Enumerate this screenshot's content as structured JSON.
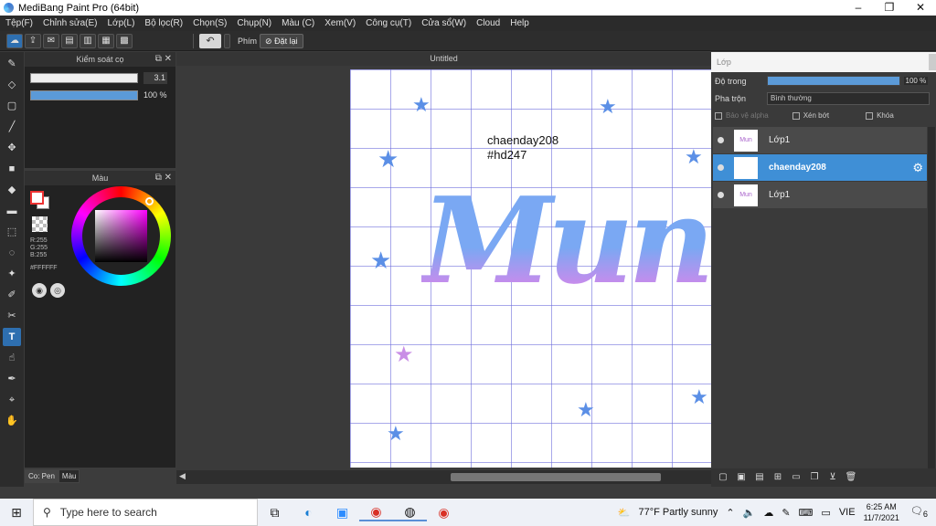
{
  "window": {
    "title": "MediBang Paint Pro (64bit)",
    "controls": [
      "–",
      "❐",
      "✕"
    ]
  },
  "menu": [
    "Tệp(F)",
    "Chỉnh sửa(E)",
    "Lớp(L)",
    "Bộ lọc(R)",
    "Chọn(S)",
    "Chụp(N)",
    "Màu (C)",
    "Xem(V)",
    "Công cụ(T)",
    "Cửa sổ(W)",
    "Cloud",
    "Help"
  ],
  "toolbar": {
    "snap_label": "Phím",
    "reset_label": "Đặt lại"
  },
  "brush_panel": {
    "title": "Kiểm soát cọ",
    "size_value": "3.1",
    "opacity_value": "100 %"
  },
  "color_panel": {
    "title": "Màu",
    "r": "R:255",
    "g": "G:255",
    "b": "B:255",
    "hex": "#FFFFFF"
  },
  "bottom_tabs": {
    "pen": "Co: Pen",
    "color": "Màu"
  },
  "document": {
    "tab_title": "Untitled",
    "text_line1": "chaenday208",
    "text_line2": "#hd247",
    "art_word": "Mun"
  },
  "layer_panel": {
    "title": "Lớp",
    "opacity_label": "Độ trong",
    "opacity_value": "100 %",
    "blend_label": "Pha trộn",
    "blend_value": "Bình thường",
    "protect_alpha": "Bảo vệ alpha",
    "clip": "Xén bớt",
    "lock": "Khóa",
    "layers": [
      {
        "name": "Lớp1",
        "thumb": "Mun",
        "selected": false
      },
      {
        "name": "chaenday208",
        "thumb": "",
        "selected": true
      },
      {
        "name": "Lớp1",
        "thumb": "Mun",
        "selected": false
      }
    ]
  },
  "taskbar": {
    "search_placeholder": "Type here to search",
    "weather": "77°F  Partly sunny",
    "lang": "VIE",
    "time": "6:25 AM",
    "date": "11/7/2021",
    "notif": "6"
  }
}
